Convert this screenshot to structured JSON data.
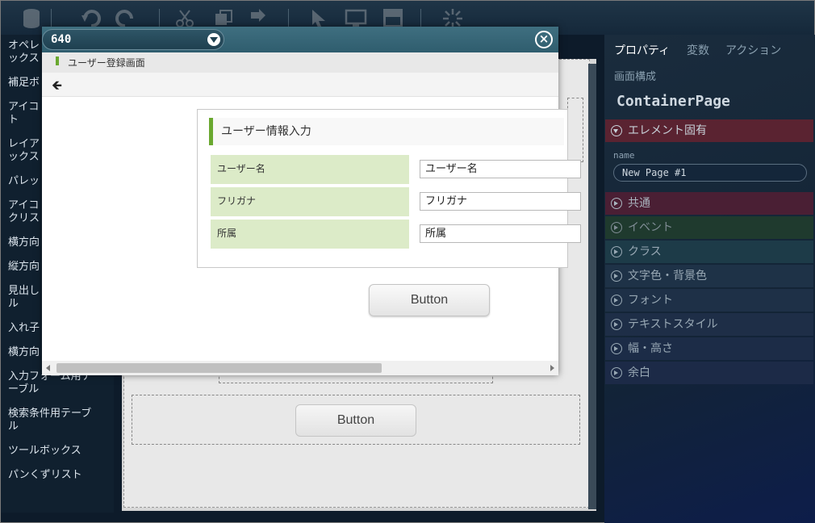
{
  "palette": {
    "items": [
      "オペレ\nックス",
      "補足ボ",
      "アイコ\nト",
      "レイア\nックス",
      "パレッ",
      "アイコ\nクリス",
      "横方向",
      "縦方向",
      "見出し\nル",
      "入れ子",
      "横方向",
      "入力フォーム用テ\nーブル",
      "検索条件用テーブ\nル",
      "ツールボックス",
      "パンくずリスト"
    ]
  },
  "canvas": {
    "button_label": "Button"
  },
  "preview": {
    "size_value": "640",
    "close_icon": "×",
    "screen_title": "ユーザー登録画面",
    "back_icon": "🡸",
    "form_title": "ユーザー情報入力",
    "fields": [
      {
        "label": "ユーザー名",
        "value": "ユーザー名"
      },
      {
        "label": "フリガナ",
        "value": "フリガナ"
      },
      {
        "label": "所属",
        "value": "所属"
      }
    ],
    "button_label": "Button"
  },
  "props": {
    "tabs": [
      "プロパティ",
      "変数",
      "アクション"
    ],
    "sub_tab": "画面構成",
    "container_title": "ContainerPage",
    "sections": [
      {
        "label": "エレメント固有",
        "color": "#c7d0d8",
        "bg": "#5a2331",
        "expanded": true
      },
      {
        "label": "共通",
        "color": "#aab6c0",
        "bg": "#4a1f34"
      },
      {
        "label": "イベント",
        "color": "#7f8c94",
        "bg": "#1f3a2e"
      },
      {
        "label": "クラス",
        "color": "#98a8b4",
        "bg": "#1d3b48"
      },
      {
        "label": "文字色・背景色",
        "color": "#98a8b4",
        "bg": "#1e3247"
      },
      {
        "label": "フォント",
        "color": "#98a8b4",
        "bg": "#1e3047"
      },
      {
        "label": "テキストスタイル",
        "color": "#98a8b4",
        "bg": "#1e2e47"
      },
      {
        "label": "幅・高さ",
        "color": "#98a8b4",
        "bg": "#1c2c47"
      },
      {
        "label": "余白",
        "color": "#98a8b4",
        "bg": "#1c2a47"
      }
    ],
    "name_label": "name",
    "name_value": "New Page #1"
  }
}
